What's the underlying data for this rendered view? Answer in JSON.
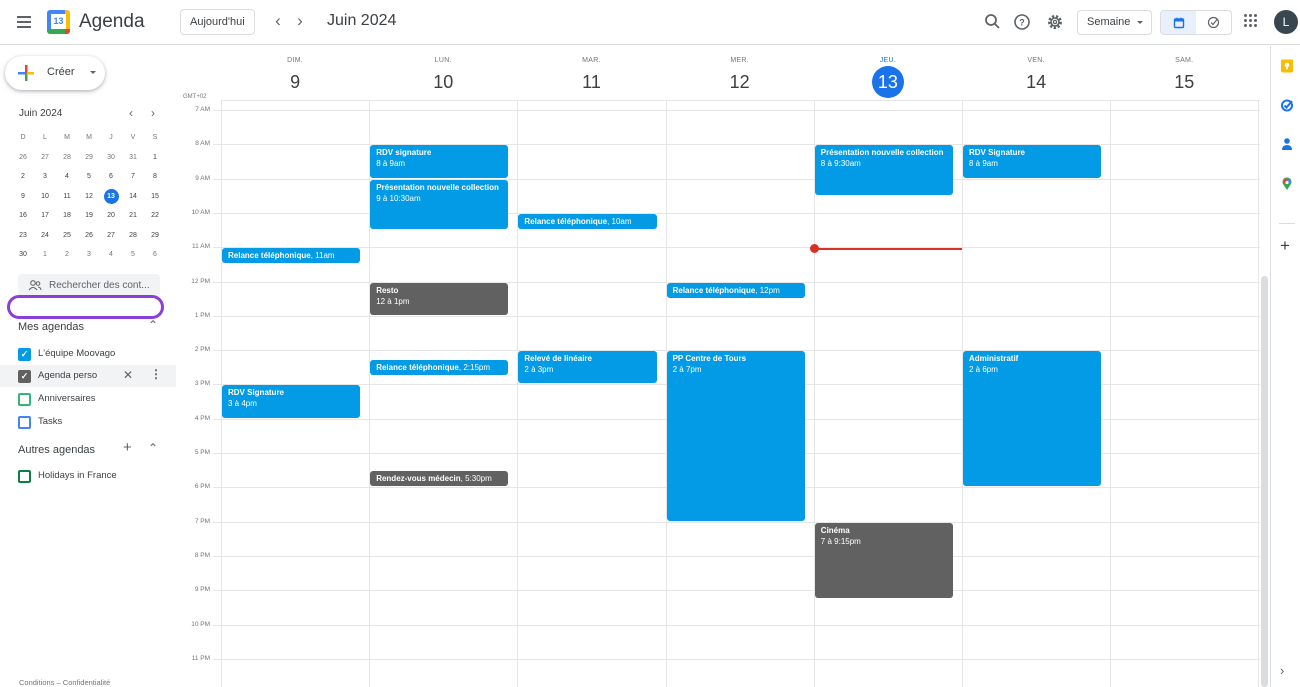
{
  "header": {
    "app_title": "Agenda",
    "logo_day": "13",
    "today_label": "Aujourd'hui",
    "period_title": "Juin 2024",
    "view_select": "Semaine",
    "avatar_initial": "L",
    "icons": [
      "menu-icon",
      "search-icon",
      "help-icon",
      "gear-icon",
      "calendar-view-icon",
      "tasks-view-icon",
      "apps-icon"
    ]
  },
  "sidebar": {
    "create_label": "Créer",
    "mini_calendar": {
      "title": "Juin 2024",
      "weekday_heads": [
        "D",
        "L",
        "M",
        "M",
        "J",
        "V",
        "S"
      ],
      "weeks": [
        [
          "26",
          "27",
          "28",
          "29",
          "30",
          "31",
          "1"
        ],
        [
          "2",
          "3",
          "4",
          "5",
          "6",
          "7",
          "8"
        ],
        [
          "9",
          "10",
          "11",
          "12",
          "13",
          "14",
          "15"
        ],
        [
          "16",
          "17",
          "18",
          "19",
          "20",
          "21",
          "22"
        ],
        [
          "23",
          "24",
          "25",
          "26",
          "27",
          "28",
          "29"
        ],
        [
          "30",
          "1",
          "2",
          "3",
          "4",
          "5",
          "6"
        ]
      ],
      "today": "13"
    },
    "people_search_placeholder": "Rechercher des cont...",
    "my_calendars_title": "Mes agendas",
    "my_calendars": [
      {
        "name": "L'équipe Moovago",
        "checked": true,
        "color": "#039be5"
      },
      {
        "name": "Agenda perso",
        "checked": true,
        "color": "#616161"
      },
      {
        "name": "Anniversaires",
        "checked": false,
        "color": "#33b679"
      },
      {
        "name": "Tasks",
        "checked": false,
        "color": "#4285f4"
      }
    ],
    "other_calendars_title": "Autres agendas",
    "other_calendars": [
      {
        "name": "Holidays in France",
        "checked": false,
        "color": "#0b8043"
      }
    ],
    "footer": "Conditions – Confidentialité"
  },
  "week": {
    "timezone": "GMT+02",
    "days": [
      {
        "dow": "DIM.",
        "num": "9"
      },
      {
        "dow": "LUN.",
        "num": "10"
      },
      {
        "dow": "MAR.",
        "num": "11"
      },
      {
        "dow": "MER.",
        "num": "12"
      },
      {
        "dow": "JEU.",
        "num": "13",
        "today": true
      },
      {
        "dow": "VEN.",
        "num": "14"
      },
      {
        "dow": "SAM.",
        "num": "15"
      }
    ],
    "hours": [
      "7 AM",
      "8 AM",
      "9 AM",
      "10 AM",
      "11 AM",
      "12 PM",
      "1 PM",
      "2 PM",
      "3 PM",
      "4 PM",
      "5 PM",
      "6 PM",
      "7 PM",
      "8 PM",
      "9 PM",
      "10 PM",
      "11 PM"
    ],
    "first_hour": 7,
    "now_hour": 11.05,
    "now_day": 4,
    "colors": {
      "team": "#039be5",
      "perso": "#616161",
      "now": "#d93025"
    },
    "events": [
      {
        "day": 1,
        "start": 8,
        "end": 9,
        "title": "RDV signature",
        "time": "8 à 9am",
        "cal": "team"
      },
      {
        "day": 1,
        "start": 9,
        "end": 10.5,
        "title": "Présentation nouvelle collection",
        "time": "9 à 10:30am",
        "cal": "team"
      },
      {
        "day": 2,
        "start": 10,
        "end": 10.5,
        "title": "Relance téléphonique",
        "time": "10am",
        "cal": "team",
        "inline": true
      },
      {
        "day": 0,
        "start": 11,
        "end": 11.5,
        "title": "Relance téléphonique",
        "time": "11am",
        "cal": "team",
        "inline": true
      },
      {
        "day": 1,
        "start": 12,
        "end": 13,
        "title": "Resto",
        "time": "12 à 1pm",
        "cal": "perso"
      },
      {
        "day": 3,
        "start": 12,
        "end": 12.5,
        "title": "Relance téléphonique",
        "time": "12pm",
        "cal": "team",
        "inline": true
      },
      {
        "day": 1,
        "start": 14.25,
        "end": 14.75,
        "title": "Relance téléphonique",
        "time": "2:15pm",
        "cal": "team",
        "inline": true
      },
      {
        "day": 2,
        "start": 14,
        "end": 15,
        "title": "Relevé de linéaire",
        "time": "2 à 3pm",
        "cal": "team"
      },
      {
        "day": 3,
        "start": 14,
        "end": 19,
        "title": "PP Centre de Tours",
        "time": "2 à 7pm",
        "cal": "team"
      },
      {
        "day": 5,
        "start": 14,
        "end": 18,
        "title": "Administratif",
        "time": "2 à 6pm",
        "cal": "team"
      },
      {
        "day": 0,
        "start": 15,
        "end": 16,
        "title": "RDV Signature",
        "time": "3 à 4pm",
        "cal": "team"
      },
      {
        "day": 1,
        "start": 17.5,
        "end": 18,
        "title": "Rendez-vous médecin",
        "time": "5:30pm",
        "cal": "perso",
        "inline": true
      },
      {
        "day": 4,
        "start": 8,
        "end": 9.5,
        "title": "Présentation nouvelle collection",
        "time": "8 à 9:30am",
        "cal": "team"
      },
      {
        "day": 5,
        "start": 8,
        "end": 9,
        "title": "RDV Signature",
        "time": "8 à 9am",
        "cal": "team"
      },
      {
        "day": 4,
        "start": 19,
        "end": 21.25,
        "title": "Cinéma",
        "time": "7 à 9:15pm",
        "cal": "perso"
      }
    ]
  },
  "side_panel": {
    "icons": [
      "keep-icon",
      "tasks-icon",
      "contacts-icon",
      "maps-icon",
      "add-addon-icon",
      "expand-panel-icon"
    ]
  }
}
